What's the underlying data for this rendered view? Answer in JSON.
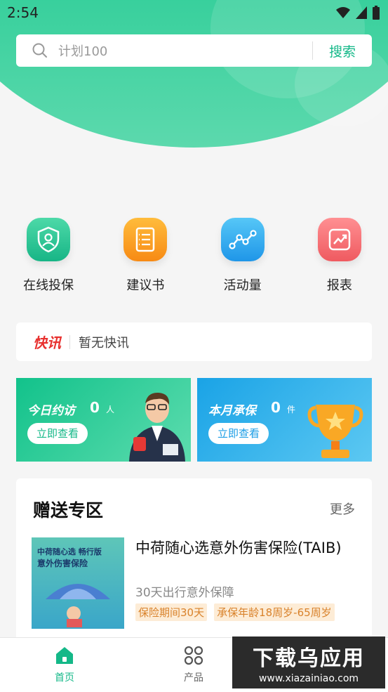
{
  "status_bar": {
    "time": "2:54"
  },
  "search": {
    "placeholder": "计划100",
    "button_label": "搜索"
  },
  "quick_actions": [
    {
      "label": "在线投保",
      "icon": "shield-user-icon",
      "color": "#2ec795"
    },
    {
      "label": "建议书",
      "icon": "notebook-icon",
      "color": "#f79a1e"
    },
    {
      "label": "活动量",
      "icon": "trend-line-icon",
      "color": "#2ba7ee"
    },
    {
      "label": "报表",
      "icon": "chart-report-icon",
      "color": "#f3666b"
    }
  ],
  "news": {
    "logo_part1": "快",
    "logo_part2": "讯",
    "text": "暂无快讯"
  },
  "stats": {
    "visits": {
      "title": "今日约访",
      "value": "0",
      "unit": "人",
      "button": "立即查看"
    },
    "policies": {
      "title": "本月承保",
      "value": "0",
      "unit": "件",
      "button": "立即查看"
    }
  },
  "gift_section": {
    "title": "赠送专区",
    "more": "更多",
    "product": {
      "thumb_line1": "中荷随心选 畅行版",
      "thumb_line2": "意外伤害保险",
      "name": "中荷随心选意外伤害保险(TAIB)",
      "desc": "30天出行意外保障",
      "tags": [
        "保险期间30天",
        "承保年龄18周岁-65周岁"
      ]
    }
  },
  "bottom_nav": [
    {
      "label": "首页",
      "icon": "home-icon",
      "active": true
    },
    {
      "label": "产品",
      "icon": "grid-icon",
      "active": false
    }
  ],
  "watermark": {
    "main": "下载乌应用",
    "sub": "www.xiazainiao.com"
  },
  "colors": {
    "brand": "#14b888",
    "nav_active": "#14b888",
    "nav_inactive": "#666666"
  }
}
